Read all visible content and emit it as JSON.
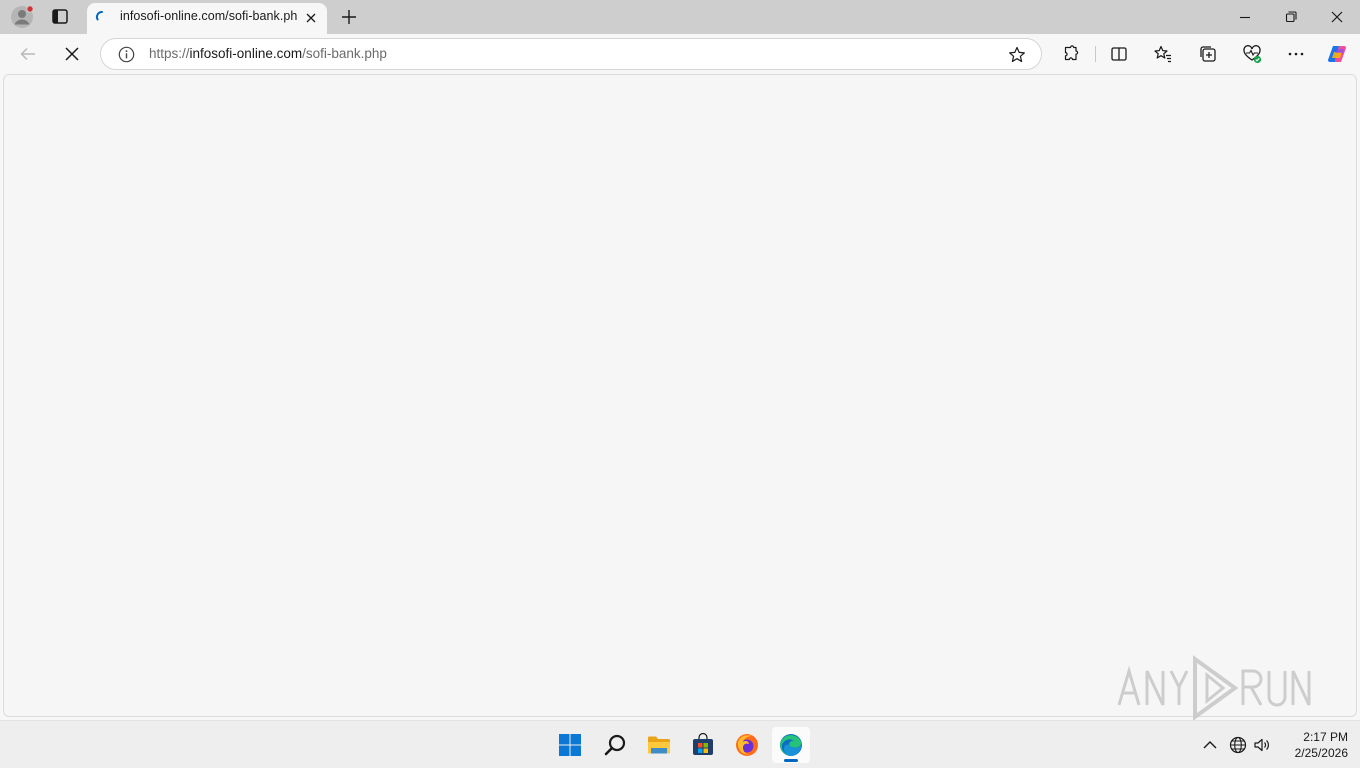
{
  "browser": {
    "tab": {
      "title": "infosofi-online.com/sofi-bank.php"
    },
    "address_bar": {
      "url_scheme": "https://",
      "url_host": "infosofi-online.com",
      "url_path": "/sofi-bank.php"
    },
    "page": {
      "state": "loading",
      "content": ""
    }
  },
  "taskbar": {
    "apps": [
      {
        "name": "start",
        "icon": "windows-logo-icon"
      },
      {
        "name": "search",
        "icon": "search-icon"
      },
      {
        "name": "file-explorer",
        "icon": "folder-icon"
      },
      {
        "name": "microsoft-store",
        "icon": "store-icon"
      },
      {
        "name": "firefox",
        "icon": "firefox-icon"
      },
      {
        "name": "edge",
        "icon": "edge-icon",
        "active": true
      }
    ],
    "clock": {
      "time": "2:17 PM",
      "date": "2/25/2026"
    }
  },
  "colors": {
    "accent": "#0067c0",
    "tabstrip": "#cecece",
    "page_background": "#f6f6f6"
  }
}
